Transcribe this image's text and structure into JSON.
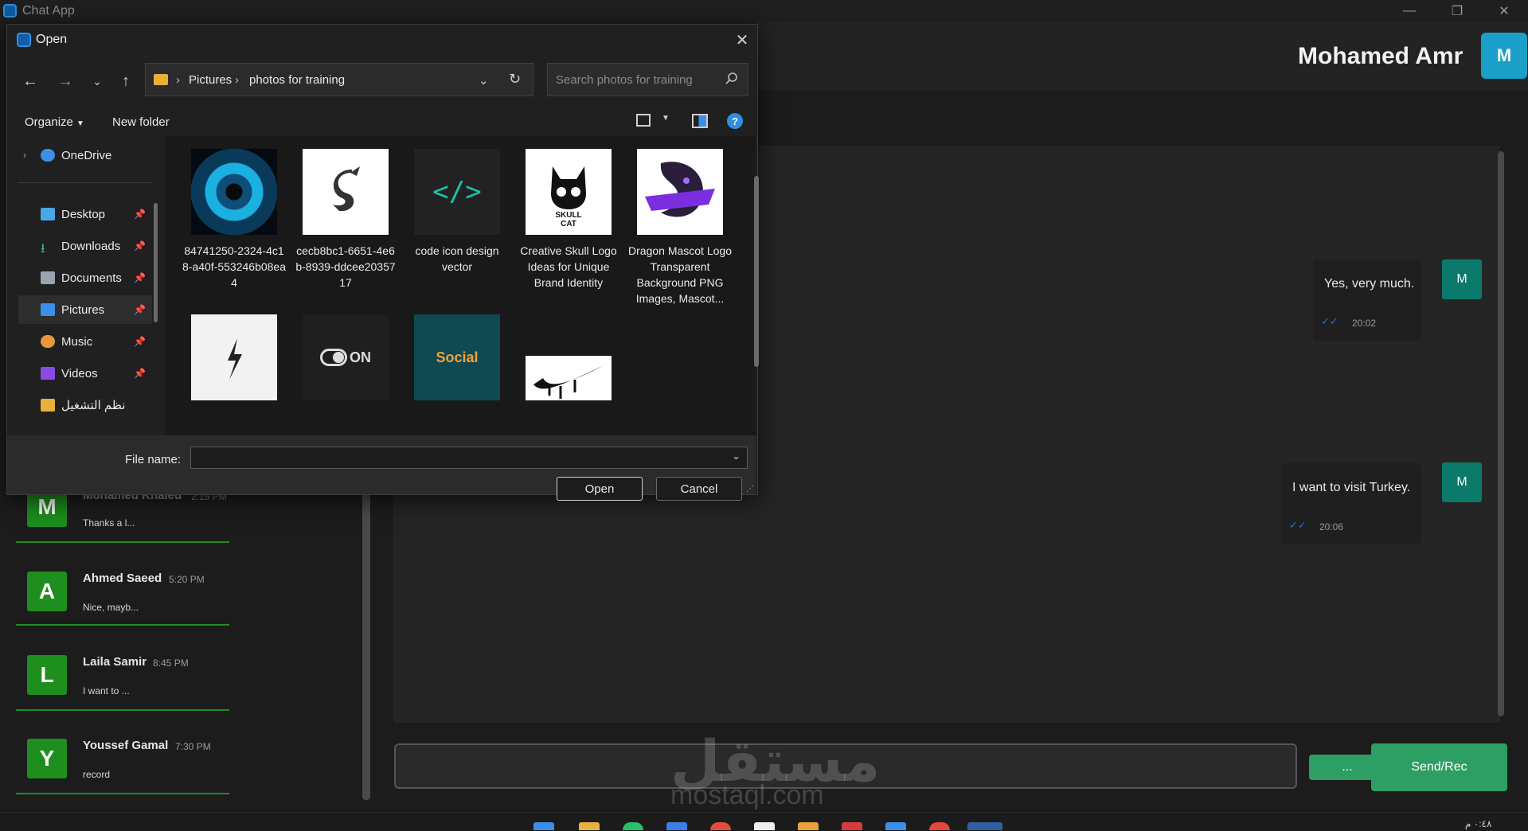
{
  "app": {
    "title": "Chat App"
  },
  "header": {
    "user_name": "Mohamed Amr",
    "avatar_letter": "M"
  },
  "messages": [
    {
      "text": "Yes, very much.",
      "time": "20:02",
      "avatar": "M",
      "ticks": "✓✓"
    },
    {
      "text": "I want to visit Turkey.",
      "time": "20:06",
      "avatar": "M",
      "ticks": "✓✓"
    }
  ],
  "composer": {
    "more_label": "...",
    "send_label": "Send/Rec"
  },
  "contacts": [
    {
      "letter": "M",
      "name": "Mohamed Khaled",
      "time": "2:15 PM",
      "preview": "Thanks a l..."
    },
    {
      "letter": "A",
      "name": "Ahmed Saeed",
      "time": "5:20 PM",
      "preview": "Nice, mayb..."
    },
    {
      "letter": "L",
      "name": "Laila Samir",
      "time": "8:45 PM",
      "preview": "I want to ..."
    },
    {
      "letter": "Y",
      "name": "Youssef Gamal",
      "time": "7:30 PM",
      "preview": "record"
    }
  ],
  "dialog": {
    "title": "Open",
    "breadcrumb": [
      "Pictures",
      "photos for training"
    ],
    "search_placeholder": "Search photos for training",
    "organize_label": "Organize",
    "new_folder_label": "New folder",
    "nav_items": [
      "OneDrive",
      "Desktop",
      "Downloads",
      "Documents",
      "Pictures",
      "Music",
      "Videos",
      "نظم التشغيل"
    ],
    "files": [
      {
        "name": "84741250-2324-4c18-a40f-553246b08ea4"
      },
      {
        "name": "cecb8bc1-6651-4e6b-8939-ddcee2035717"
      },
      {
        "name": "code icon design vector"
      },
      {
        "name": "Creative Skull Logo Ideas for Unique Brand Identity"
      },
      {
        "name": "Dragon Mascot Logo Transparent Background PNG Images,  Mascot..."
      }
    ],
    "thumb_texts": {
      "skull": "SKULL CAT",
      "code": "</>",
      "on": "ON",
      "social": "Social"
    },
    "file_name_label": "File name:",
    "file_name_value": "",
    "open_label": "Open",
    "cancel_label": "Cancel"
  },
  "watermark": {
    "arabic": "مستقل",
    "latin": "mostaql.com"
  },
  "taskbar": {
    "clock": "٠:٤٨ م"
  }
}
